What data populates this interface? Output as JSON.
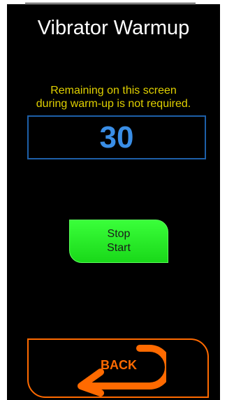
{
  "screen": {
    "title": "Vibrator Warmup",
    "notice_lines": [
      "Remaining on this screen",
      "during warm-up is not required."
    ],
    "counter_value": "30"
  },
  "buttons": {
    "stop_start_lines": [
      "Stop",
      "Start"
    ],
    "back_label": "BACK",
    "back_icon": "u-turn-back-arrow-icon"
  },
  "colors": {
    "background": "#000000",
    "title_text": "#ffffff",
    "notice_text": "#e0d000",
    "counter_text": "#3a8ee6",
    "counter_border": "#1d5fa8",
    "stop_start_fill": "#2ef02e",
    "back_accent": "#ff6a00"
  }
}
